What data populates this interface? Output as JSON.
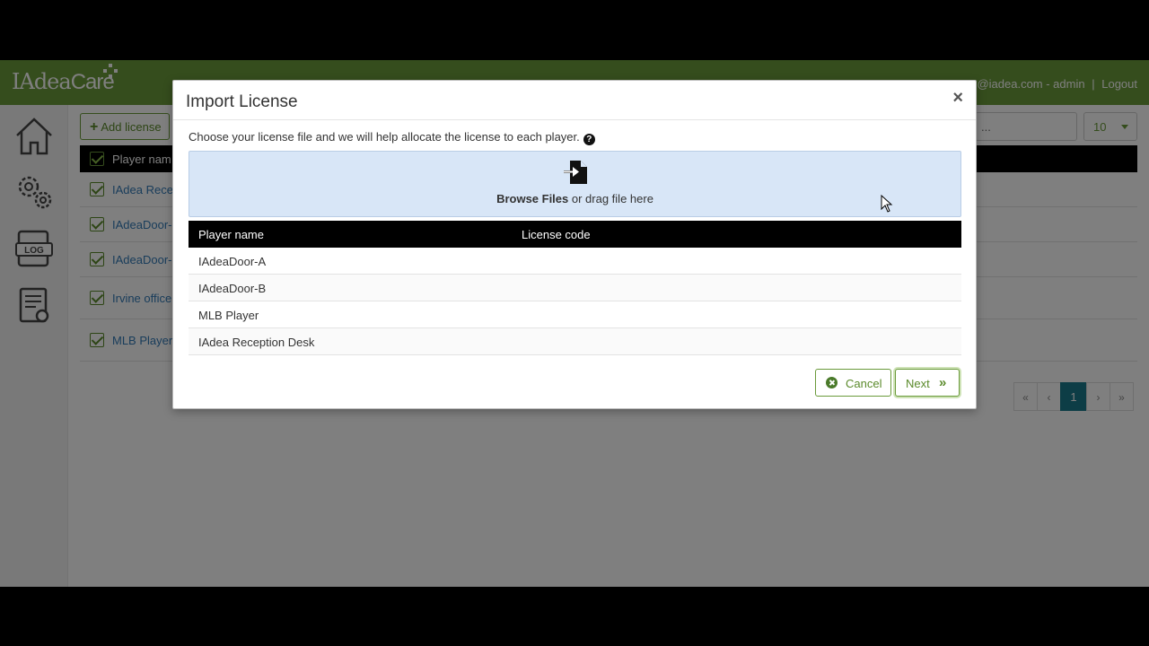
{
  "app": {
    "logo_text": "IAdea",
    "logo_suffix": "Care",
    "user_email": "@iadea.com - admin",
    "separator": "|",
    "logout": "Logout"
  },
  "sidebar": {
    "items": [
      {
        "icon": "home-icon"
      },
      {
        "icon": "settings-icon"
      },
      {
        "icon": "log-icon"
      },
      {
        "icon": "license-icon"
      }
    ]
  },
  "toolbar": {
    "add_license_label": "Add license",
    "search_placeholder": "...",
    "page_size": "10"
  },
  "background_table": {
    "header": "Player nam",
    "rows": [
      "IAdea Rece",
      "IAdeaDoor-",
      "IAdeaDoor-",
      "Irvine office",
      "MLB Player"
    ]
  },
  "pagination": {
    "first": "«",
    "prev": "‹",
    "current": "1",
    "next": "›",
    "last": "»"
  },
  "modal": {
    "title": "Import License",
    "close": "×",
    "intro": "Choose your license file and we will help allocate the license to each player.",
    "help_icon": "?",
    "dropzone_bold": "Browse Files",
    "dropzone_rest": " or drag file here",
    "table": {
      "columns": [
        "Player name",
        "License code"
      ],
      "rows": [
        {
          "player": "IAdeaDoor-A",
          "code": ""
        },
        {
          "player": "IAdeaDoor-B",
          "code": ""
        },
        {
          "player": "MLB Player",
          "code": ""
        },
        {
          "player": "IAdea Reception Desk",
          "code": ""
        }
      ]
    },
    "cancel_label": "Cancel",
    "next_label": "Next",
    "next_icon": "»"
  },
  "colors": {
    "brand_green": "#6a9a3a",
    "dropzone_bg": "#d8e6f7",
    "active_page": "#1a7a8c"
  }
}
